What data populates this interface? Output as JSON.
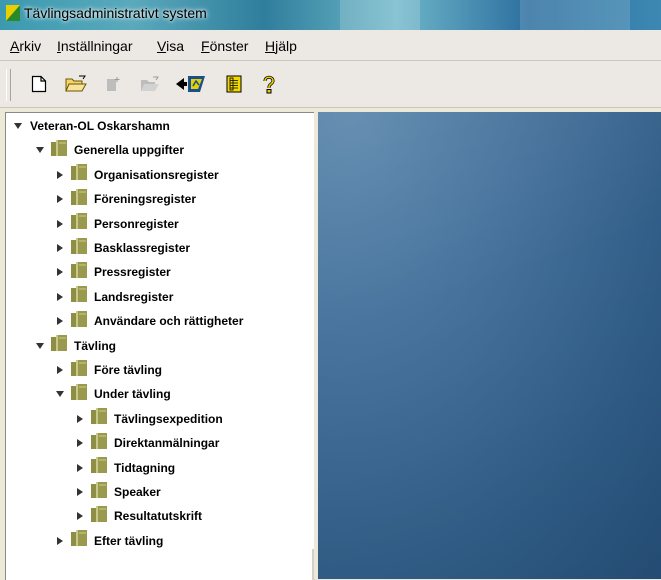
{
  "window": {
    "title": "Tävlingsadministrativt system"
  },
  "menu": [
    {
      "pre": "",
      "u": "A",
      "post": "rkiv"
    },
    {
      "pre": "",
      "u": "I",
      "post": "nställningar"
    },
    {
      "pre": "",
      "u": "V",
      "post": "isa"
    },
    {
      "pre": "",
      "u": "F",
      "post": "önster"
    },
    {
      "pre": "",
      "u": "H",
      "post": "jälp"
    }
  ],
  "toolbar": {
    "buttons": [
      {
        "name": "new-document-icon"
      },
      {
        "name": "open-folder-icon"
      },
      {
        "name": "new-item-disabled-icon"
      },
      {
        "name": "open-item-disabled-icon"
      },
      {
        "name": "back-flag-icon"
      },
      {
        "name": "list-icon"
      },
      {
        "name": "help-icon"
      }
    ]
  },
  "tree": [
    {
      "label": "Veteran-OL Oskarshamn",
      "level": 0,
      "expanded": true,
      "folder": false
    },
    {
      "label": "Generella uppgifter",
      "level": 1,
      "expanded": true,
      "folder": true
    },
    {
      "label": "Organisationsregister",
      "level": 2,
      "expanded": false,
      "folder": true
    },
    {
      "label": "Föreningsregister",
      "level": 2,
      "expanded": false,
      "folder": true
    },
    {
      "label": "Personregister",
      "level": 2,
      "expanded": false,
      "folder": true
    },
    {
      "label": "Basklassregister",
      "level": 2,
      "expanded": false,
      "folder": true
    },
    {
      "label": "Pressregister",
      "level": 2,
      "expanded": false,
      "folder": true
    },
    {
      "label": "Landsregister",
      "level": 2,
      "expanded": false,
      "folder": true
    },
    {
      "label": "Användare och rättigheter",
      "level": 2,
      "expanded": false,
      "folder": true
    },
    {
      "label": "Tävling",
      "level": 1,
      "expanded": true,
      "folder": true
    },
    {
      "label": "Före tävling",
      "level": 2,
      "expanded": false,
      "folder": true
    },
    {
      "label": "Under tävling",
      "level": 2,
      "expanded": true,
      "folder": true
    },
    {
      "label": "Tävlingsexpedition",
      "level": 3,
      "expanded": false,
      "folder": true
    },
    {
      "label": "Direktanmälningar",
      "level": 3,
      "expanded": false,
      "folder": true
    },
    {
      "label": "Tidtagning",
      "level": 3,
      "expanded": false,
      "folder": true
    },
    {
      "label": "Speaker",
      "level": 3,
      "expanded": false,
      "folder": true
    },
    {
      "label": "Resultatutskrift",
      "level": 3,
      "expanded": false,
      "folder": true
    },
    {
      "label": "Efter tävling",
      "level": 2,
      "expanded": false,
      "folder": true
    }
  ],
  "colors": {
    "desktop": "#3a6892",
    "folder": "#9a9a4e"
  }
}
